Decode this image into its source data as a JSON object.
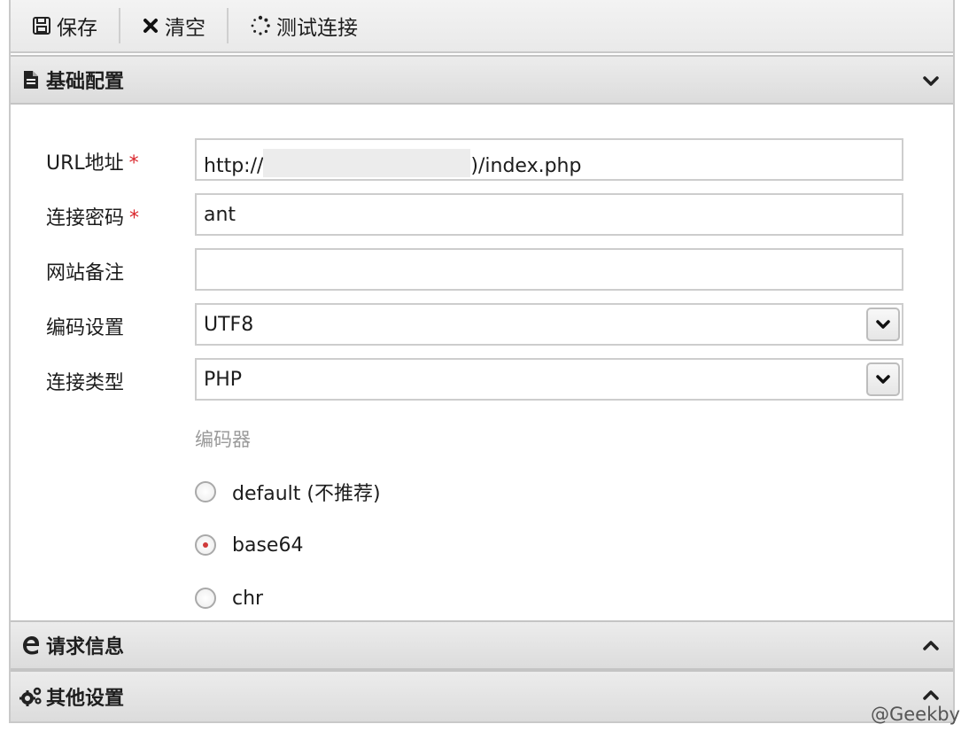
{
  "toolbar": {
    "save_label": "保存",
    "clear_label": "清空",
    "test_label": "测试连接"
  },
  "sections": {
    "basic": "基础配置",
    "request": "请求信息",
    "other": "其他设置"
  },
  "form": {
    "url_label": "URL地址",
    "url_prefix": "http://",
    "url_suffix": ")/index.php",
    "password_label": "连接密码",
    "password_value": "ant",
    "note_label": "网站备注",
    "note_value": "",
    "encoding_label": "编码设置",
    "encoding_value": "UTF8",
    "type_label": "连接类型",
    "type_value": "PHP",
    "required_mark": "*"
  },
  "encoder": {
    "title": "编码器",
    "options": [
      {
        "label": "default (不推荐)",
        "checked": false
      },
      {
        "label": "base64",
        "checked": true
      },
      {
        "label": "chr",
        "checked": false
      }
    ]
  },
  "watermark": "@Geekby",
  "icons": {
    "save": "floppy-icon",
    "clear": "close-icon",
    "test": "spinner-icon",
    "basic": "file-icon",
    "request": "edge-icon",
    "other": "gears-icon"
  }
}
